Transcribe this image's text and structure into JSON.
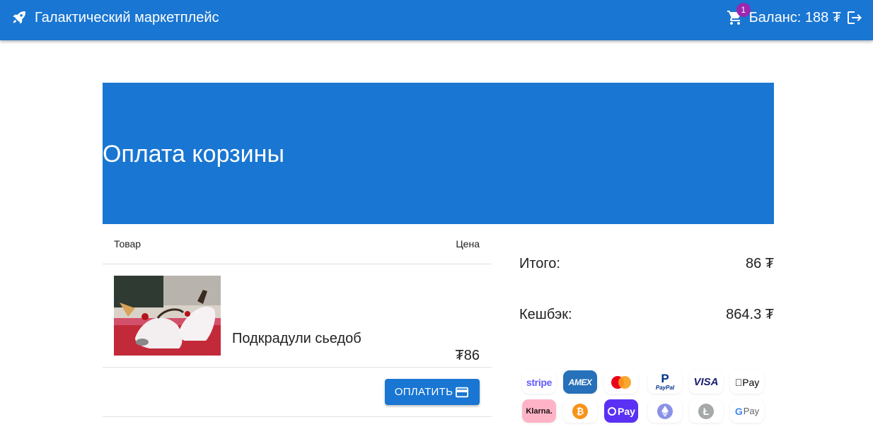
{
  "appbar": {
    "title": "Галактический маркетплейс",
    "cart_count": "1",
    "balance": "Баланс: 188 ₮"
  },
  "hero": {
    "title": "Оплата корзины"
  },
  "table": {
    "col_item": "Товар",
    "col_price": "Цена",
    "rows": [
      {
        "name": "Подкрадули сьедоб",
        "price": "₮86"
      }
    ],
    "pay_label": "ОПЛАТИТЬ"
  },
  "summary": {
    "total_label": "Итого:",
    "total_value": "86 ₮",
    "cashback_label": "Кешбэк:",
    "cashback_value": "864.3 ₮"
  },
  "payments": {
    "stripe": "stripe",
    "amex": "AMEX",
    "paypal": "PayPal",
    "visa": "VISA",
    "applepay": "Pay",
    "klarna": "Klarna.",
    "opay": "Pay",
    "gpay": "Pay"
  },
  "colors": {
    "primary": "#1976d2",
    "badge": "#9c27b0"
  }
}
